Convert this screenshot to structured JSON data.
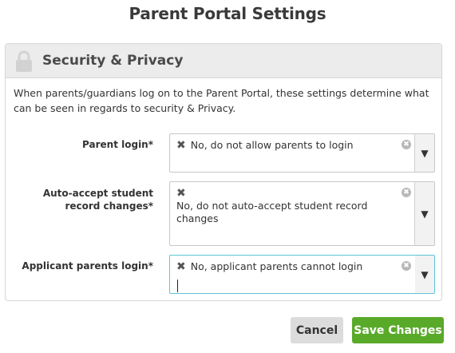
{
  "page": {
    "title": "Parent Portal Settings"
  },
  "section": {
    "icon": "lock-icon",
    "title": "Security & Privacy",
    "description": "When parents/guardians log on to the Parent Portal, these settings determine what can be seen in regards to security & Privacy."
  },
  "settings": [
    {
      "label": "Parent login*",
      "value": "No, do not allow parents to login"
    },
    {
      "label": "Auto-accept student record changes*",
      "value": "No, do not auto-accept student record changes"
    },
    {
      "label": "Applicant parents login*",
      "value": "No, applicant parents cannot login"
    }
  ],
  "icons": {
    "remove": "✖",
    "clear": "✖",
    "dropdown": "▼"
  },
  "buttons": {
    "cancel": "Cancel",
    "save": "Save Changes"
  },
  "colors": {
    "save_button": "#5aaa2a",
    "focus_border": "#5cc6d6",
    "header_bg": "#ececec"
  }
}
